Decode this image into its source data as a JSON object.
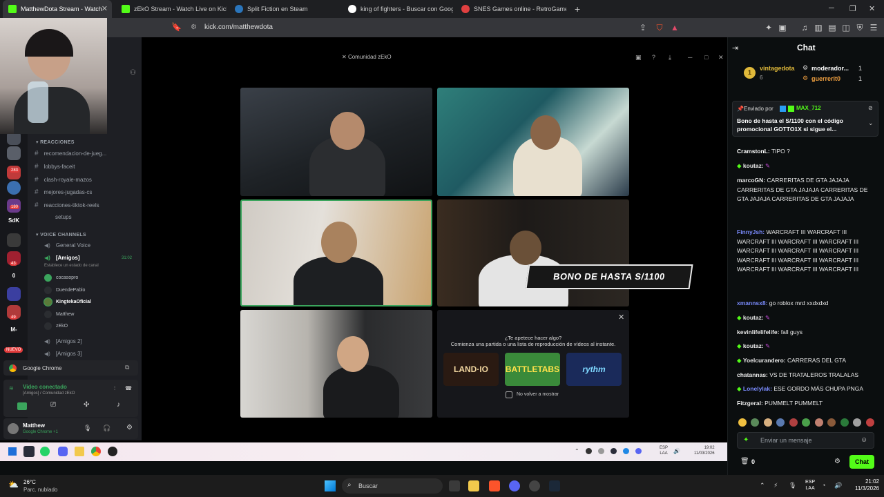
{
  "tabs": [
    {
      "label": "MatthewDota Stream - Watch",
      "color": "#53fc18"
    },
    {
      "label": "zEkO Stream - Watch Live on Kick",
      "color": "#53fc18"
    },
    {
      "label": "Split Fiction en Steam",
      "color": "#2a75bb"
    },
    {
      "label": "king of fighters - Buscar con Google",
      "color": "#ffffff"
    },
    {
      "label": "SNES Games online - RetroGames.cc",
      "color": "#e04040"
    }
  ],
  "address": {
    "url": "kick.com/matthewdota"
  },
  "discord": {
    "window_title": "Comunidad zEkO",
    "rail": [
      {
        "label": "",
        "color": "#4a4f59"
      },
      {
        "label": "",
        "color": "#3b6fb0"
      },
      {
        "label": "",
        "color": "#6a3a8a"
      },
      {
        "label": "SdK",
        "color": "#2b2d31"
      },
      {
        "label": "",
        "color": "#3a3a3a"
      },
      {
        "label": "",
        "color": "#a02030"
      },
      {
        "label": "0",
        "color": "#2b2d31"
      },
      {
        "label": "",
        "color": "#3b3fa0"
      },
      {
        "label": "",
        "color": "#b03a3a"
      },
      {
        "label": "M-",
        "color": "#2b2d31"
      }
    ],
    "rail_badges": [
      "283",
      "180",
      "43",
      "49"
    ],
    "nuevo_label": "NUEVO",
    "reactions_category": "REACCIONES",
    "text_channels": [
      "recomendacion-de-jueg...",
      "lobbys-faceit",
      "clash-royale-mazos",
      "mejores-jugadas-cs",
      "reacciones-tiktok-reels",
      "setups"
    ],
    "voice_category": "VOICE CHANNELS",
    "general_voice": "General Voice",
    "amigos": {
      "name": "[Amigos]",
      "status": "Establece un estado de canal",
      "timer": "31:02"
    },
    "members": [
      "cocasopro",
      "DuendePablo",
      "KingtekaOficial",
      "Matthew",
      "zEkO"
    ],
    "amigos2": "[Amigos 2]",
    "amigos3": "[Amigos 3]",
    "chrome_label": "Google Chrome",
    "video_connected": "Video conectado",
    "video_location": "[Amigos] / Comunidad zEkO",
    "user_name": "Matthew",
    "user_status": "Google Chrome +1"
  },
  "stream": {
    "bono_text": "BONO DE HASTA S/1100",
    "promo_title": "¿Te apetece hacer algo?",
    "promo_subtitle": "Comienza una partida o una lista de reproducción de vídeos al instante.",
    "games": [
      {
        "label": "LAND·IO",
        "color": "#2a1a12"
      },
      {
        "label": "BATTLETABS",
        "color": "#3a8a3a"
      },
      {
        "label": "rythm",
        "color": "#1a2a5a"
      }
    ],
    "no_show_label": "No volver a mostrar",
    "inner_clock": {
      "time": "19:02",
      "date": "11/03/2026",
      "lang": "ESP",
      "region": "LAA"
    }
  },
  "chat": {
    "header": "Chat",
    "leader": {
      "rank": "1",
      "name": "vintagedota",
      "count": "6"
    },
    "mods": [
      {
        "name": "moderador...",
        "count": "1"
      },
      {
        "name": "guerrerit0",
        "count": "1"
      }
    ],
    "pinned": {
      "sent_by_label": "Enviado por",
      "sender": "MAX_712",
      "text": "Bono de hasta el S/1100 con el código promocional GOTTO1X si sigue el..."
    },
    "messages": [
      {
        "user": "CramstonL:",
        "text": " TIPO ?",
        "color": "#ffffff"
      },
      {
        "user": "koutaz:",
        "text": "",
        "color": "#ffffff"
      },
      {
        "user": "marcoGN:",
        "text": " CARRERITAS DE GTA JAJAJA  CARRERITAS DE GTA JAJAJA  CARRERITAS DE GTA JAJAJA  CARRERITAS DE GTA JAJAJA",
        "color": "#ffffff"
      },
      {
        "user": "FinnyJsh:",
        "text": " WARCRAFT III  WARCRAFT III  WARCRAFT III  WARCRAFT III  WARCRAFT III  WARCRAFT III  WARCRAFT III  WARCRAFT III  WARCRAFT III  WARCRAFT III  WARCRAFT III  WARCRAFT III  WARCRAFT III  WARCRAFT III",
        "color": "#7b8cff"
      },
      {
        "user": "xmannsx8:",
        "text": " go roblox mrd xxdxdxd",
        "color": "#7b8cff"
      },
      {
        "user": "koutaz:",
        "text": "",
        "color": "#ffffff"
      },
      {
        "user": "kevinlifelifelife:",
        "text": " fall guys",
        "color": "#ffffff"
      },
      {
        "user": "koutaz:",
        "text": "",
        "color": "#ffffff"
      },
      {
        "user": "Yoelcurandero:",
        "text": " CARRERAS DEL GTA",
        "color": "#ffffff"
      },
      {
        "user": "chatannas:",
        "text": " VS DE TRATALEROS TRALALAS",
        "color": "#ffffff"
      },
      {
        "user": "Lonelylak:",
        "text": " ESE GORDO MÁS CHUPA PNGA",
        "color": "#7b8cff"
      },
      {
        "user": "Fitzgeral:",
        "text": " PUMMELT PUMMELT",
        "color": "#ffffff"
      }
    ],
    "placeholder": "Enviar un mensaje",
    "points": "0",
    "send_label": "Chat"
  },
  "taskbar": {
    "weather_temp": "26°C",
    "weather_desc": "Parc. nublado",
    "search": "Buscar",
    "lang": "ESP",
    "region": "LAA",
    "time": "21:02",
    "date": "11/3/2026"
  }
}
